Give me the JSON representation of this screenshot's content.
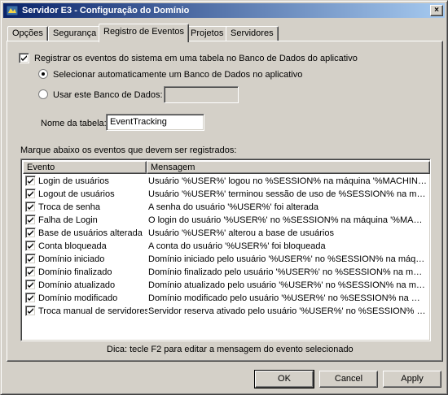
{
  "window": {
    "title": "Servidor E3 - Configuração do Domínio",
    "close_label": "×"
  },
  "tabs": [
    {
      "label": "Opções",
      "active": false
    },
    {
      "label": "Segurança",
      "active": false
    },
    {
      "label": "Registro de Eventos",
      "active": true
    },
    {
      "label": "Projetos",
      "active": false
    },
    {
      "label": "Servidores",
      "active": false
    }
  ],
  "settings": {
    "register_label": "Registrar os eventos do sistema em uma tabela no Banco de Dados do aplicativo",
    "register_checked": true,
    "auto_db_label": "Selecionar automaticamente um Banco de Dados no aplicativo",
    "auto_db_selected": true,
    "use_db_label": "Usar este Banco de Dados:",
    "use_db_value": "",
    "table_name_label": "Nome da tabela:",
    "table_name_value": "EventTracking",
    "events_instruction": "Marque abaixo os eventos que devem ser registrados:"
  },
  "events_table": {
    "columns": [
      "Evento",
      "Mensagem"
    ],
    "rows": [
      {
        "event": "Login de usuários",
        "message": "Usuário '%USER%' logou no %SESSION% na máquina '%MACHINE%'",
        "checked": true
      },
      {
        "event": "Logout de usuários",
        "message": "Usuário '%USER%' terminou sessão de uso de %SESSION% na máquina '%MACHINE%'",
        "checked": true
      },
      {
        "event": "Troca de senha",
        "message": "A senha do usuário '%USER%' foi alterada",
        "checked": true
      },
      {
        "event": "Falha de Login",
        "message": "O login do usuário '%USER%' no %SESSION% na máquina '%MACHINE%' falhou",
        "checked": true
      },
      {
        "event": "Base de usuários alterada",
        "message": "Usuário '%USER%' alterou a base de usuários",
        "checked": true
      },
      {
        "event": "Conta bloqueada",
        "message": "A conta do usuário '%USER%' foi bloqueada",
        "checked": true
      },
      {
        "event": "Domínio iniciado",
        "message": "Domínio iniciado pelo usuário '%USER%' no %SESSION% na máquina '%MACHINE%'",
        "checked": true
      },
      {
        "event": "Domínio finalizado",
        "message": "Domínio finalizado pelo usuário '%USER%' no %SESSION% na máquina '%MACHINE%'",
        "checked": true
      },
      {
        "event": "Domínio atualizado",
        "message": "Domínio atualizado pelo usuário '%USER%' no %SESSION% na máquina '%MACHINE%'",
        "checked": true
      },
      {
        "event": "Domínio modificado",
        "message": "Domínio modificado pelo usuário '%USER%' no %SESSION% na máquina '%MACHINE%'",
        "checked": true
      },
      {
        "event": "Troca manual de servidores",
        "message": "Servidor reserva ativado pelo usuário '%USER%' no %SESSION% na máquina '%MACHINE%'",
        "checked": true
      }
    ]
  },
  "hint": "Dica:  tecle F2 para editar a mensagem do evento selecionado",
  "buttons": {
    "ok": "OK",
    "cancel": "Cancel",
    "apply": "Apply"
  },
  "icons": {
    "app": "app-server-icon",
    "check": "checkmark-icon",
    "radio": "radio-dot-icon"
  },
  "colors": {
    "face": "#d4d0c8",
    "title_start": "#0a246a",
    "title_end": "#a6caf0"
  }
}
